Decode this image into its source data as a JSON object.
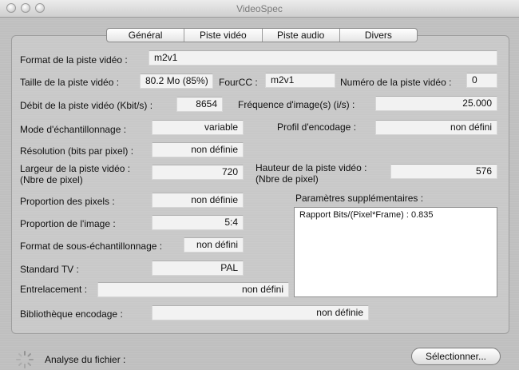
{
  "window": {
    "title": "VideoSpec"
  },
  "tabs": [
    "Général",
    "Piste vidéo",
    "Piste audio",
    "Divers"
  ],
  "fields": {
    "format_label": "Format de la piste vidéo :",
    "format_value": "m2v1",
    "size_label": "Taille de la piste vidéo :",
    "size_value": "80.2 Mo (85%)",
    "fourcc_label": "FourCC :",
    "fourcc_value": "m2v1",
    "track_num_label": "Numéro de la piste vidéo :",
    "track_num_value": "0",
    "bitrate_label": "Débit de la piste vidéo (Kbit/s) :",
    "bitrate_value": "8654",
    "fps_label": "Fréquence d'image(s) (i/s) :",
    "fps_value": "25.000",
    "sampling_label": "Mode d'échantillonnage :",
    "sampling_value": "variable",
    "profile_label": "Profil d'encodage :",
    "profile_value": "non défini",
    "resolution_label": "Résolution (bits par pixel) :",
    "resolution_value": "non définie",
    "width_label_1": "Largeur de la piste vidéo :",
    "width_label_2": "(Nbre de pixel)",
    "width_value": "720",
    "height_label_1": "Hauteur de la piste vidéo :",
    "height_label_2": "(Nbre de pixel)",
    "height_value": "576",
    "pixel_ratio_label": "Proportion des pixels :",
    "pixel_ratio_value": "non définie",
    "image_ratio_label": "Proportion de l'image :",
    "image_ratio_value": "5:4",
    "subsampling_label": "Format de sous-échantillonnage :",
    "subsampling_value": "non défini",
    "tv_standard_label": "Standard TV :",
    "tv_standard_value": "PAL",
    "interlace_label": "Entrelacement :",
    "interlace_value": "non défini",
    "encoder_lib_label": "Bibliothèque encodage :",
    "encoder_lib_value": "non définie",
    "extra_params_label": "Paramètres supplémentaires :",
    "extra_params_value": "Rapport Bits/(Pixel*Frame) : 0.835"
  },
  "footer": {
    "analysis_label": "Analyse du fichier :",
    "select_button": "Sélectionner..."
  }
}
